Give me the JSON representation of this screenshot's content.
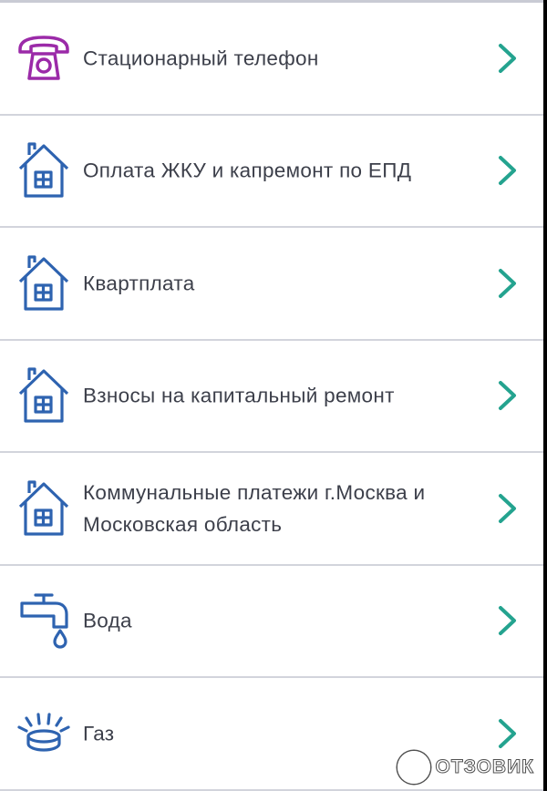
{
  "items": [
    {
      "label": "Стационарный телефон",
      "icon": "landline-phone-icon",
      "icon_color": "#9b2aa8"
    },
    {
      "label": "Оплата ЖКУ и капремонт по ЕПД",
      "icon": "house-icon",
      "icon_color": "#2e63b0"
    },
    {
      "label": "Квартплата",
      "icon": "house-icon",
      "icon_color": "#2e63b0"
    },
    {
      "label": "Взносы на капитальный ремонт",
      "icon": "house-icon",
      "icon_color": "#2e63b0"
    },
    {
      "label": "Коммунальные платежи г.Москва и Московская область",
      "icon": "house-icon",
      "icon_color": "#2e63b0"
    },
    {
      "label": "Вода",
      "icon": "water-tap-icon",
      "icon_color": "#2e63b0"
    },
    {
      "label": "Газ",
      "icon": "gas-burner-icon",
      "icon_color": "#2e63b0"
    }
  ],
  "chevron_color": "#24a38f",
  "watermark": {
    "text": "ОТЗОВИК"
  }
}
